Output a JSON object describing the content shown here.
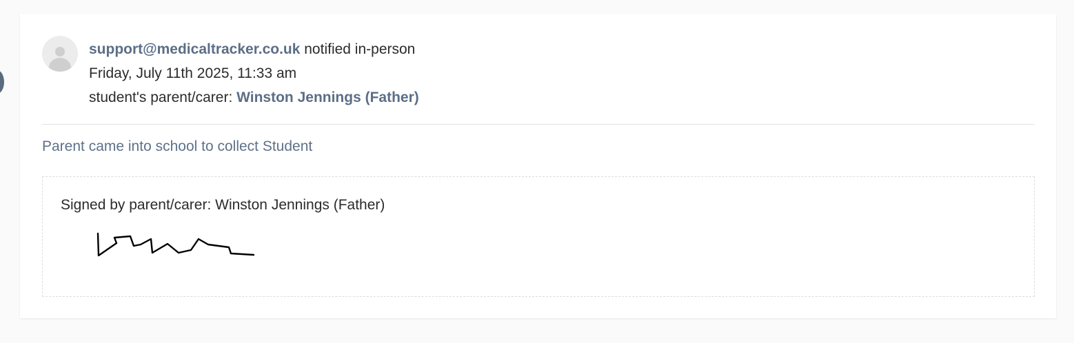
{
  "entry": {
    "author_email": "support@medicaltracker.co.uk",
    "action": " notified in-person",
    "timestamp": "Friday, July 11th 2025, 11:33 am",
    "contact_prefix": "student's parent/carer: ",
    "contact_name": "Winston Jennings (Father)",
    "note": "Parent came into school to collect Student",
    "signed_by": "Signed by parent/carer: Winston Jennings (Father)",
    "avatar_icon": "user-placeholder-icon",
    "signature_image": "handwritten-signature"
  },
  "colors": {
    "accent": "#5b6e86",
    "note_text": "#5e7189",
    "timeline_dot": "#5a6b80"
  }
}
